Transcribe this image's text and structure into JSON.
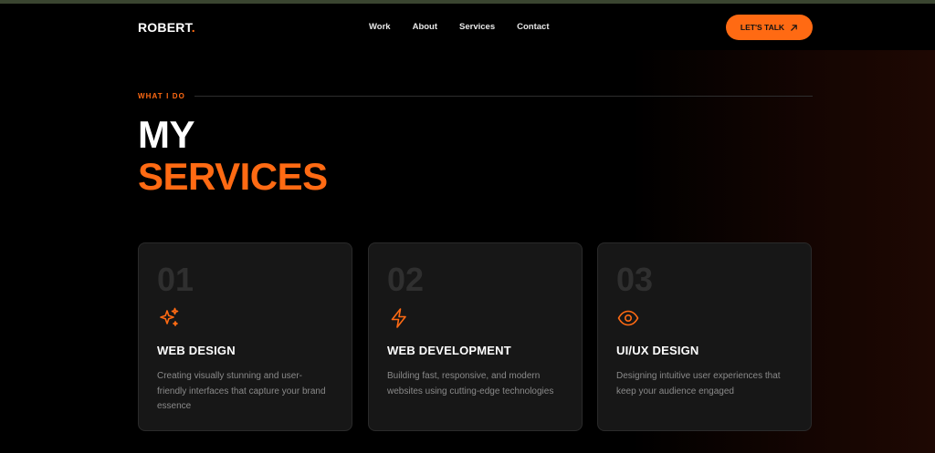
{
  "brand": {
    "name": "ROBERT",
    "dot": "."
  },
  "nav": {
    "links": [
      "Work",
      "About",
      "Services",
      "Contact"
    ],
    "cta_label": "LET'S TALK"
  },
  "section": {
    "eyebrow": "WHAT I DO",
    "title_line1": "MY",
    "title_line2": "SERVICES"
  },
  "services": [
    {
      "number": "01",
      "icon": "sparkles-icon",
      "title": "WEB DESIGN",
      "description": "Creating visually stunning and user-friendly interfaces that capture your brand essence"
    },
    {
      "number": "02",
      "icon": "lightning-icon",
      "title": "WEB DEVELOPMENT",
      "description": "Building fast, responsive, and modern websites using cutting-edge technologies"
    },
    {
      "number": "03",
      "icon": "eye-icon",
      "title": "UI/UX DESIGN",
      "description": "Designing intuitive user experiences that keep your audience engaged"
    }
  ],
  "colors": {
    "accent": "#ff6a13",
    "background": "#000000",
    "card": "#171717",
    "card_number": "#2f2f2f",
    "muted_text": "#8a8a8a"
  }
}
